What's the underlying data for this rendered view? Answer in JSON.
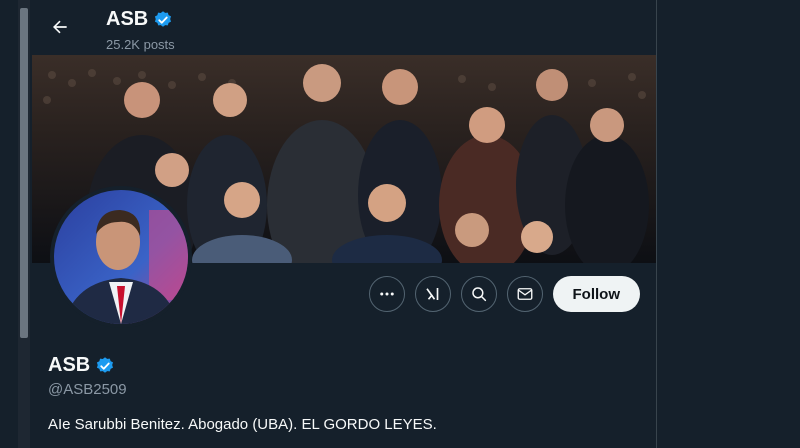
{
  "topbar": {
    "name": "ASB",
    "posts": "25.2K posts",
    "back_icon": "arrow-left-icon"
  },
  "banner": {
    "description": "group photo on stage in front of crowd"
  },
  "actions": {
    "more_icon": "more-horizontal-icon",
    "grok_icon": "grok-icon",
    "search_icon": "search-icon",
    "message_icon": "envelope-icon",
    "follow_label": "Follow"
  },
  "profile": {
    "name": "ASB",
    "handle": "@ASB2509",
    "bio": "AIe Sarubbi Benitez. Abogado (UBA). EL GORDO LEYES.",
    "verified_icon": "verified-badge-icon"
  },
  "colors": {
    "background": "#15202b",
    "verified": "#1d9bf0",
    "follow_bg": "#eff3f4",
    "secondary_text": "#8b98a5"
  }
}
